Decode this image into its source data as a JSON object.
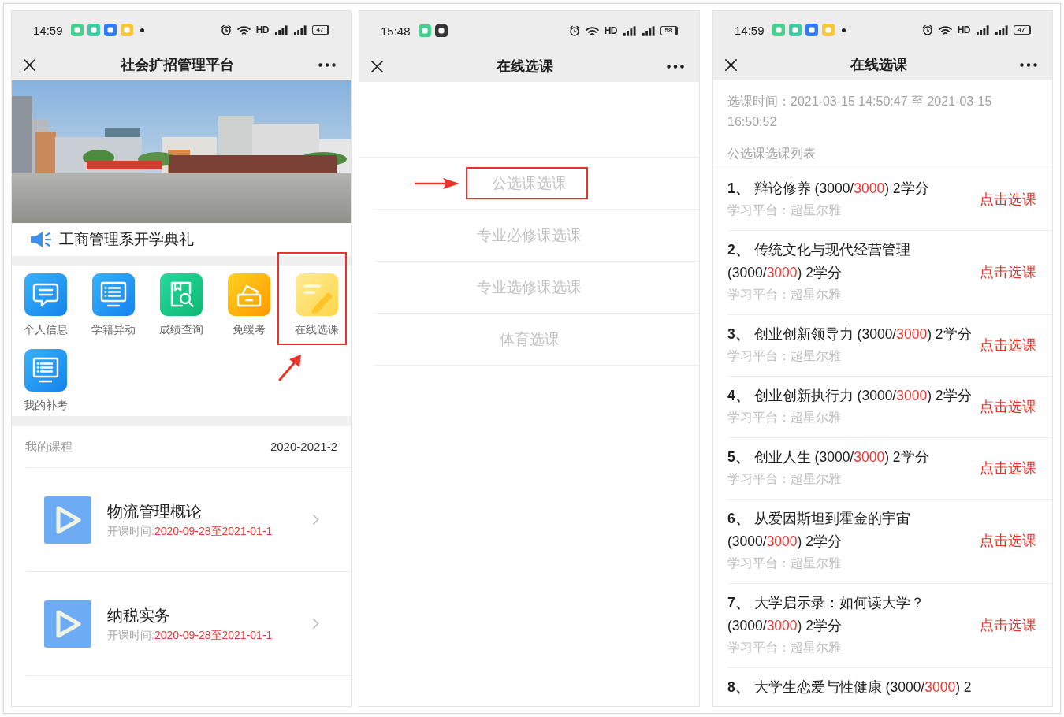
{
  "screens": [
    {
      "kind": "home",
      "status_bar": {
        "time": "14:59",
        "apps": [
          {
            "color": "#43d18e"
          },
          {
            "color": "#3cc9a5"
          },
          {
            "color": "#2f7df6"
          },
          {
            "color": "#f7c63c"
          }
        ],
        "notification_dot": true,
        "network": "HD",
        "battery": "47"
      },
      "nav": {
        "title": "社会扩招管理平台"
      },
      "notice": {
        "text": "工商管理系开学典礼"
      },
      "shortcuts": [
        {
          "label": "个人信息",
          "highlighted": false
        },
        {
          "label": "学籍异动",
          "highlighted": false
        },
        {
          "label": "成绩查询",
          "highlighted": false
        },
        {
          "label": "免缓考",
          "highlighted": false
        },
        {
          "label": "在线选课",
          "highlighted": true
        },
        {
          "label": "我的补考",
          "highlighted": false
        }
      ],
      "my_courses": {
        "title": "我的课程",
        "term": "2020-2021-2",
        "courses": [
          {
            "name": "物流管理概论",
            "time_label": "开课时间:",
            "time_value": "2020-09-28至2021-01-1"
          },
          {
            "name": "纳税实务",
            "time_label": "开课时间:",
            "time_value": "2020-09-28至2021-01-1"
          }
        ]
      }
    },
    {
      "kind": "menu",
      "status_bar": {
        "time": "15:48",
        "apps": [
          {
            "color": "#43d18e"
          },
          {
            "color": "#333333"
          }
        ],
        "notification_dot": false,
        "network": "HD",
        "battery": "58"
      },
      "nav": {
        "title": "在线选课"
      },
      "menu": [
        {
          "label": "公选课选课",
          "highlighted": true
        },
        {
          "label": "专业必修课选课",
          "highlighted": false
        },
        {
          "label": "专业选修课选课",
          "highlighted": false
        },
        {
          "label": "体育选课",
          "highlighted": false
        }
      ]
    },
    {
      "kind": "list",
      "status_bar": {
        "time": "14:59",
        "apps": [
          {
            "color": "#43d18e"
          },
          {
            "color": "#3cc9a5"
          },
          {
            "color": "#2f7df6"
          },
          {
            "color": "#f7c63c"
          }
        ],
        "notification_dot": true,
        "network": "HD",
        "battery": "47"
      },
      "nav": {
        "title": "在线选课"
      },
      "period": "选课时间：2021-03-15 14:50:47 至 2021-03-15 16:50:52",
      "list_title": "公选课选课列表",
      "courses": [
        {
          "number": "1、",
          "name": "辩论修养",
          "quota_start": "(3000/",
          "quota_limit": "3000",
          "quota_end": ") 2学分",
          "platform": "学习平台：超星尔雅",
          "action": "点击选课"
        },
        {
          "number": "2、",
          "name": "传统文化与现代经营管理",
          "quota_start": "(3000/",
          "quota_limit": "3000",
          "quota_end": ") 2学分",
          "platform": "学习平台：超星尔雅",
          "action": "点击选课"
        },
        {
          "number": "3、",
          "name": "创业创新领导力",
          "quota_start": "(3000/",
          "quota_limit": "3000",
          "quota_end": ") 2学分",
          "platform": "学习平台：超星尔雅",
          "action": "点击选课"
        },
        {
          "number": "4、",
          "name": "创业创新执行力",
          "quota_start": "(3000/",
          "quota_limit": "3000",
          "quota_end": ") 2学分",
          "platform": "学习平台：超星尔雅",
          "action": "点击选课"
        },
        {
          "number": "5、",
          "name": "创业人生",
          "quota_start": "(3000/",
          "quota_limit": "3000",
          "quota_end": ") 2学分",
          "platform": "学习平台：超星尔雅",
          "action": "点击选课"
        },
        {
          "number": "6、",
          "name": "从爱因斯坦到霍金的宇宙",
          "quota_start": "(3000/",
          "quota_limit": "3000",
          "quota_end": ") 2学分",
          "platform": "学习平台：超星尔雅",
          "action": "点击选课"
        },
        {
          "number": "7、",
          "name": "大学启示录：如何读大学？",
          "quota_start": "(3000/",
          "quota_limit": "3000",
          "quota_end": ") 2学分",
          "platform": "学习平台：超星尔雅",
          "action": "点击选课"
        },
        {
          "number": "8、",
          "name": "大学生恋爱与性健康",
          "quota_start": "(3000/",
          "quota_limit": "3000",
          "quota_end": ") 2"
        }
      ]
    }
  ]
}
